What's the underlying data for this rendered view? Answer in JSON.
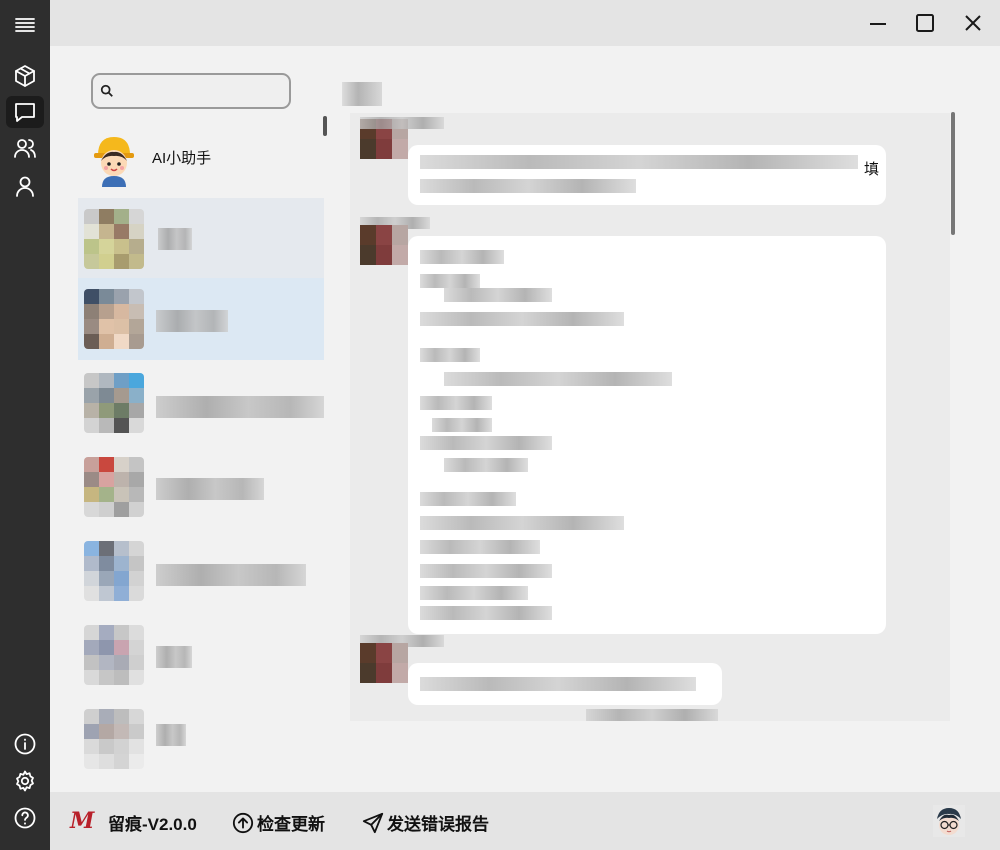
{
  "app": {
    "window_controls": {
      "minimize": "minimize",
      "maximize": "maximize",
      "close": "close"
    }
  },
  "rail": {
    "items": [
      {
        "icon": "menu-icon"
      },
      {
        "icon": "box-icon"
      },
      {
        "icon": "chat-icon",
        "active": true
      },
      {
        "icon": "contacts-icon"
      },
      {
        "icon": "user-icon"
      },
      {
        "icon": "info-icon"
      },
      {
        "icon": "settings-icon"
      },
      {
        "icon": "help-icon"
      }
    ]
  },
  "search": {
    "value": "",
    "placeholder": ""
  },
  "contacts": [
    {
      "name": "AI小助手"
    },
    {
      "name": ""
    },
    {
      "name": ""
    },
    {
      "name": ""
    },
    {
      "name": ""
    },
    {
      "name": ""
    },
    {
      "name": ""
    },
    {
      "name": ""
    }
  ],
  "chat": {
    "messages": [
      {
        "visible_fragment": "填"
      }
    ]
  },
  "footer": {
    "version_label": "留痕-V2.0.0",
    "check_update_label": "检查更新",
    "report_label": "发送错误报告",
    "accent": "#b8202a"
  }
}
